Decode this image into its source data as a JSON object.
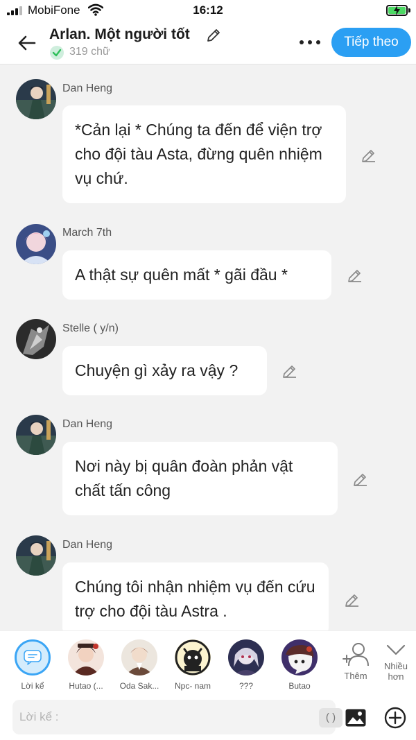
{
  "status": {
    "carrier": "MobiFone",
    "time": "16:12"
  },
  "header": {
    "title": "Arlan. Một người tốt",
    "word_count": "319 chữ",
    "next_label": "Tiếp theo"
  },
  "messages": [
    {
      "name": "Dan Heng",
      "text": "*Cản lại * Chúng ta đến để viện trợ cho đội tàu Asta, đừng quên nhiệm vụ chứ."
    },
    {
      "name": "March 7th",
      "text": "A thật sự quên mất * gãi đầu *"
    },
    {
      "name": "Stelle ( y/n)",
      "text": "Chuyện gì xảy ra vậy ?"
    },
    {
      "name": "Dan Heng",
      "text": "Nơi này bị quân đoàn phản vật chất tấn công"
    },
    {
      "name": "Dan Heng",
      "text": "Chúng tôi nhận nhiệm vụ đến cứu trợ cho đội tàu Astra ."
    }
  ],
  "characters": [
    {
      "label": "Lời kể"
    },
    {
      "label": "Hutao (..."
    },
    {
      "label": "Oda Sak..."
    },
    {
      "label": "Npc- nam"
    },
    {
      "label": "???"
    },
    {
      "label": "Butao"
    }
  ],
  "actions": {
    "add_label": "Thêm",
    "more_label": "Nhiều hơn"
  },
  "input": {
    "placeholder": "Lời kể :",
    "paren_label": "( )"
  },
  "colors": {
    "accent": "#2b9ff3",
    "check": "#2fbf5a",
    "background": "#f2f2f2"
  }
}
